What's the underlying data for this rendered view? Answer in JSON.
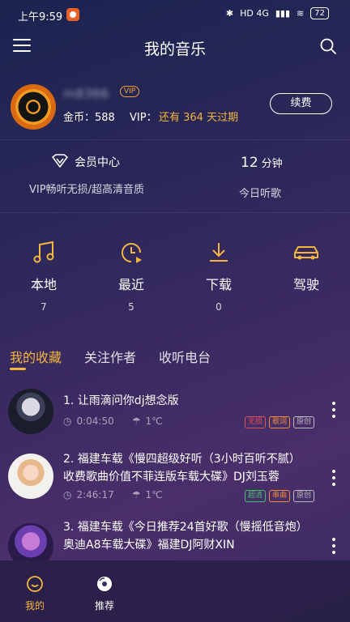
{
  "status_bar": {
    "time": "上午9:59",
    "network": "HD 4G",
    "battery": "72"
  },
  "header": {
    "title": "我的音乐"
  },
  "profile": {
    "username": "m8366",
    "vip_badge": "VIP",
    "coins_label": "金币：588",
    "vip_label": "VIP：",
    "vip_expiry": "还有 364 天过期",
    "renew_label": "续费"
  },
  "member": {
    "title": "会员中心",
    "subtitle": "VIP畅听无损/超高清音质"
  },
  "listen": {
    "minutes": "12",
    "unit": "分钟",
    "label": "今日听歌"
  },
  "quick_nav": [
    {
      "label": "本地",
      "count": "7",
      "icon": "music-note-icon"
    },
    {
      "label": "最近",
      "count": "5",
      "icon": "clock-play-icon"
    },
    {
      "label": "下载",
      "count": "0",
      "icon": "download-icon"
    },
    {
      "label": "驾驶",
      "count": "",
      "icon": "car-icon"
    }
  ],
  "tabs": [
    "我的收藏",
    "关注作者",
    "收听电台"
  ],
  "colors": {
    "accent": "#f5b63c",
    "tag_red": "#e0505a",
    "tag_orange": "#f08a3a",
    "tag_gray": "#bbbbbb",
    "tag_green": "#3fbf6a"
  },
  "songs": [
    {
      "title": "1. 让雨滴问你dj想念版",
      "duration": "0:04:50",
      "weather": "1℃",
      "tags": [
        "无损",
        "歌词",
        "原创"
      ]
    },
    {
      "title": "2. 福建车载《慢四超级好听（3小时百听不腻）收费歌曲价值不菲连版车载大碟》DJ刘玉蓉",
      "duration": "2:46:17",
      "weather": "1℃",
      "tags": [
        "超清",
        "串曲",
        "原创"
      ]
    },
    {
      "title": "3. 福建车载《今日推荐24首好歌（慢摇低音炮）奥迪A8车载大碟》福建DJ阿财XIN",
      "duration": "",
      "weather": "",
      "tags": []
    }
  ],
  "bottom_nav": [
    {
      "label": "我的",
      "icon": "my-face-icon"
    },
    {
      "label": "推荐",
      "icon": "disc-icon"
    }
  ]
}
